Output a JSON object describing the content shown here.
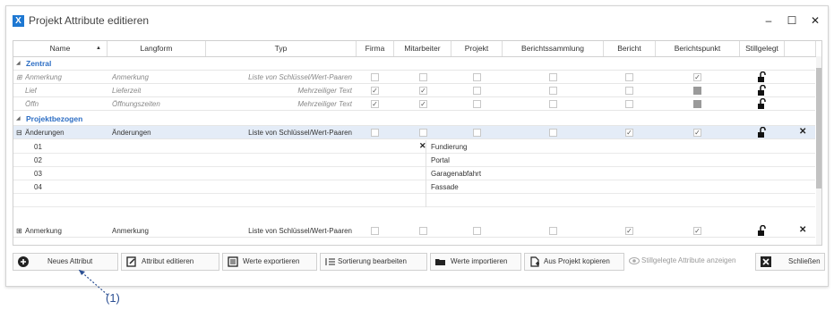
{
  "window": {
    "title": "Projekt Attribute editieren",
    "minimize": "–",
    "maximize": "☐",
    "close": "✕"
  },
  "grid": {
    "columns": [
      "Name",
      "Langform",
      "Typ",
      "Firma",
      "Mitarbeiter",
      "Projekt",
      "Berichtssammlung",
      "Bericht",
      "Berichtspunkt",
      "Stillgelegt"
    ],
    "groups": [
      {
        "label": "Zentral"
      },
      {
        "label": "Projektbezogen"
      }
    ],
    "zentral_rows": [
      {
        "name": "Anmerkung",
        "langform": "Anmerkung",
        "typ": "Liste von Schlüssel/Wert-Paaren"
      },
      {
        "name": "Lief",
        "langform": "Lieferzeit",
        "typ": "Mehrzeiliger Text"
      },
      {
        "name": "Öffn",
        "langform": "Öffnungszeiten",
        "typ": "Mehrzeiliger Text"
      }
    ],
    "projekt_rows": [
      {
        "name": "Änderungen",
        "langform": "Änderungen",
        "typ": "Liste von Schlüssel/Wert-Paaren"
      },
      {
        "name": "Anmerkung",
        "langform": "Anmerkung",
        "typ": "Liste von Schlüssel/Wert-Paaren"
      }
    ],
    "sub_rows": [
      {
        "key": "01",
        "value": "Fundierung"
      },
      {
        "key": "02",
        "value": "Portal"
      },
      {
        "key": "03",
        "value": "Garagenabfahrt"
      },
      {
        "key": "04",
        "value": "Fassade"
      }
    ],
    "expand_icon": "⊞",
    "collapse_icon": "⊟",
    "group_arrow": "◢",
    "delete_mark": "✕"
  },
  "toolbar": {
    "neues_attribut": "Neues Attribut",
    "attribut_editieren": "Attribut editieren",
    "werte_exportieren": "Werte exportieren",
    "sortierung_bearbeiten": "Sortierung bearbeiten",
    "werte_importieren": "Werte importieren",
    "aus_projekt_kopieren": "Aus Projekt kopieren",
    "stillgelegte_anzeigen": "Stillgelegte Attribute anzeigen",
    "schliessen": "Schließen"
  },
  "annotation": "(1)",
  "colors": {
    "accent": "#2d6ec4",
    "selected_row": "#e4ecf7",
    "app_icon": "#1e78d2"
  }
}
